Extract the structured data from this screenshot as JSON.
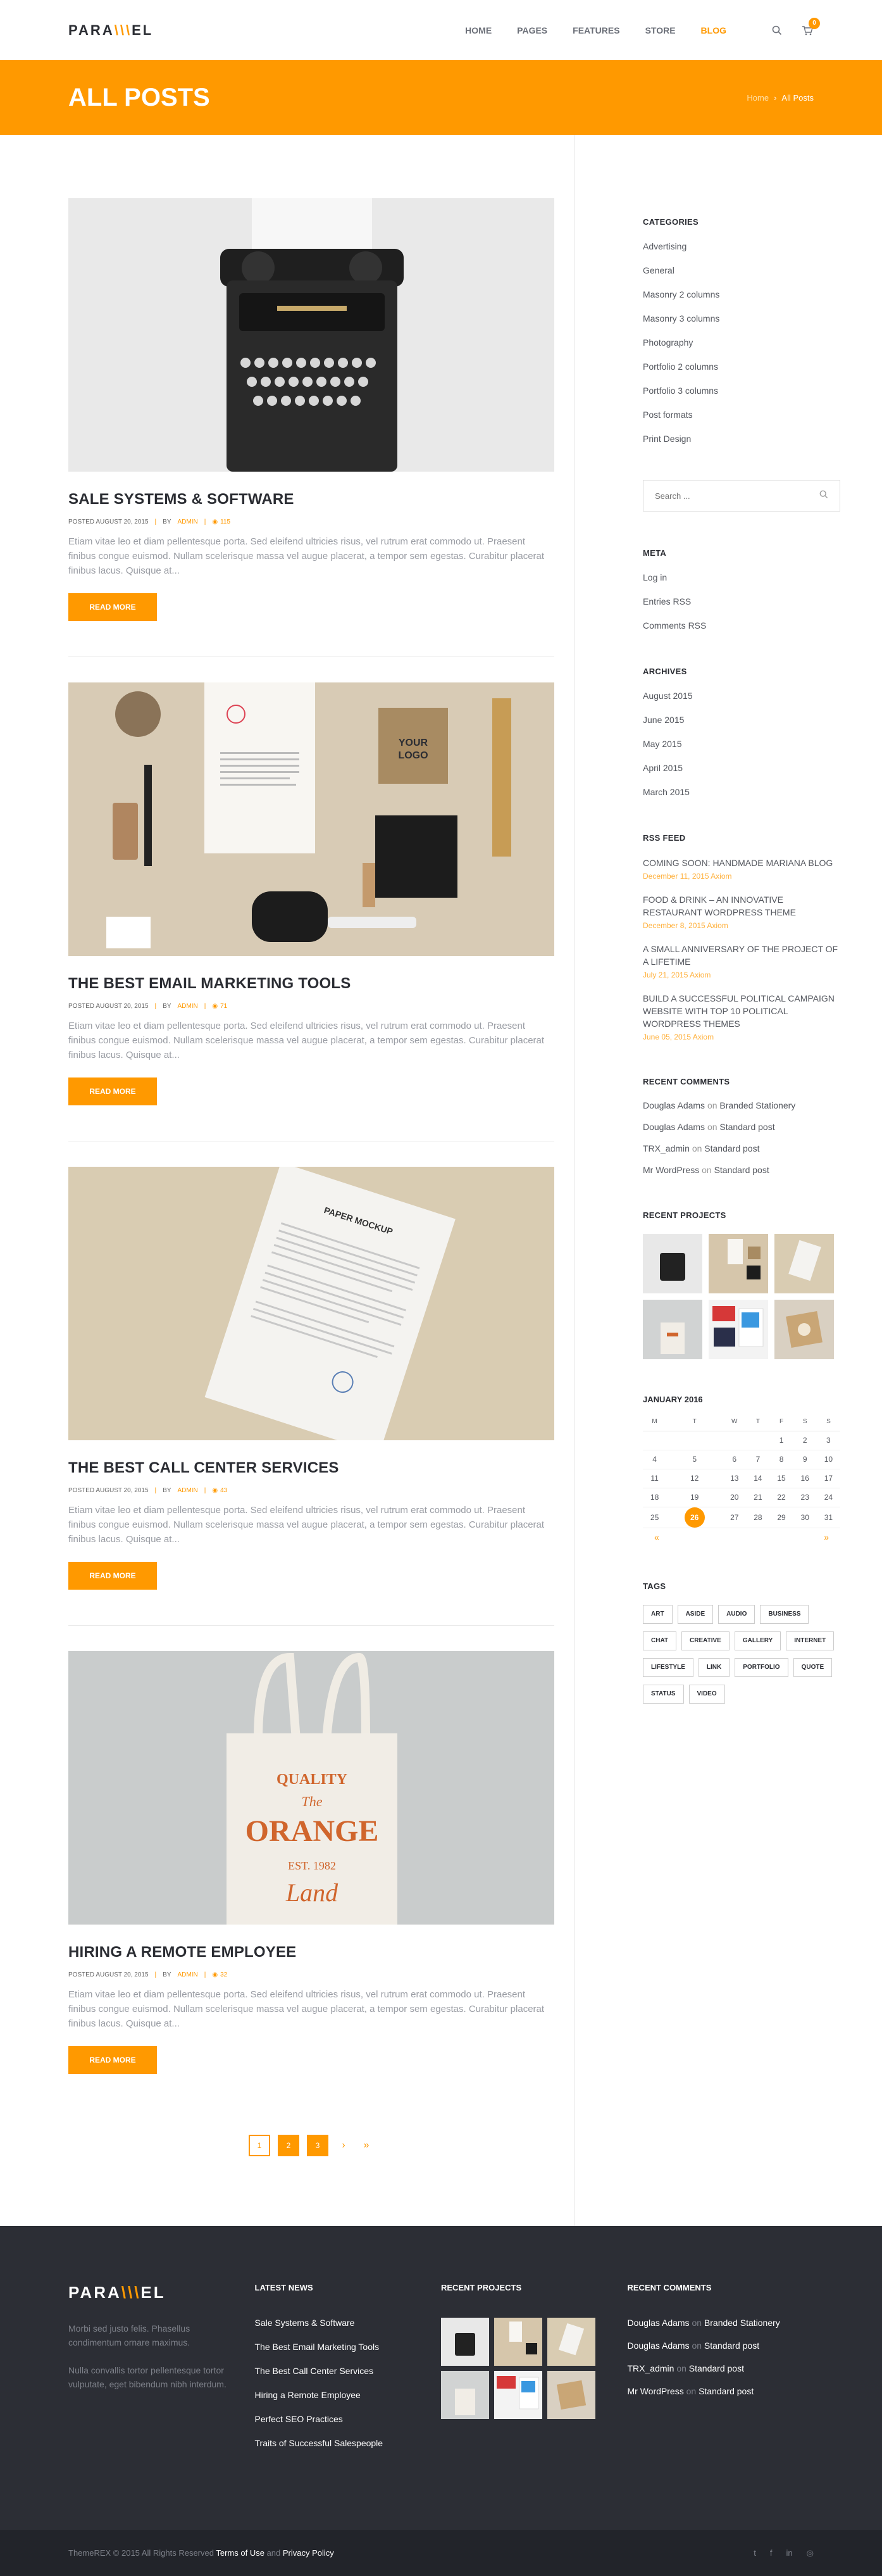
{
  "brand": {
    "logo_left": "PARA",
    "logo_slash": "\\\\\\",
    "logo_right": "EL"
  },
  "nav": {
    "items": [
      {
        "label": "HOME"
      },
      {
        "label": "PAGES"
      },
      {
        "label": "FEATURES"
      },
      {
        "label": "STORE"
      },
      {
        "label": "BLOG"
      }
    ],
    "cart_count": "0"
  },
  "titlebar": {
    "title": "ALL POSTS",
    "breadcrumb_home": "Home",
    "breadcrumb_sep": "›",
    "breadcrumb_current": "All Posts"
  },
  "posts": [
    {
      "title": "SALE SYSTEMS & SOFTWARE",
      "date": "POSTED AUGUST 20, 2015",
      "author_prefix": "BY",
      "author": "ADMIN",
      "views": "115",
      "excerpt": "Etiam vitae leo et diam pellentesque porta. Sed eleifend ultricies risus, vel rutrum erat commodo ut. Praesent finibus congue euismod. Nullam scelerisque massa vel augue placerat, a tempor sem egestas. Curabitur placerat finibus lacus. Quisque at...",
      "read_more": "READ MORE"
    },
    {
      "title": "THE BEST EMAIL MARKETING TOOLS",
      "date": "POSTED AUGUST 20, 2015",
      "author_prefix": "BY",
      "author": "ADMIN",
      "views": "71",
      "excerpt": "Etiam vitae leo et diam pellentesque porta. Sed eleifend ultricies risus, vel rutrum erat commodo ut. Praesent finibus congue euismod. Nullam scelerisque massa vel augue placerat, a tempor sem egestas. Curabitur placerat finibus lacus. Quisque at...",
      "read_more": "READ MORE"
    },
    {
      "title": "THE BEST CALL CENTER SERVICES",
      "date": "POSTED AUGUST 20, 2015",
      "author_prefix": "BY",
      "author": "ADMIN",
      "views": "43",
      "excerpt": "Etiam vitae leo et diam pellentesque porta. Sed eleifend ultricies risus, vel rutrum erat commodo ut. Praesent finibus congue euismod. Nullam scelerisque massa vel augue placerat, a tempor sem egestas. Curabitur placerat finibus lacus. Quisque at...",
      "read_more": "READ MORE"
    },
    {
      "title": "HIRING A REMOTE EMPLOYEE",
      "date": "POSTED AUGUST 20, 2015",
      "author_prefix": "BY",
      "author": "ADMIN",
      "views": "32",
      "excerpt": "Etiam vitae leo et diam pellentesque porta. Sed eleifend ultricies risus, vel rutrum erat commodo ut. Praesent finibus congue euismod. Nullam scelerisque massa vel augue placerat, a tempor sem egestas. Curabitur placerat finibus lacus. Quisque at...",
      "read_more": "READ MORE"
    }
  ],
  "pagination": {
    "pages": [
      "1",
      "2",
      "3"
    ],
    "next": "›",
    "last": "»"
  },
  "sidebar": {
    "categories_title": "CATEGORIES",
    "categories": [
      "Advertising",
      "General",
      "Masonry 2 columns",
      "Masonry 3 columns",
      "Photography",
      "Portfolio 2 columns",
      "Portfolio 3 columns",
      "Post formats",
      "Print Design"
    ],
    "search_placeholder": "Search ...",
    "meta_title": "META",
    "meta": [
      "Log in",
      "Entries RSS",
      "Comments RSS"
    ],
    "archives_title": "ARCHIVES",
    "archives": [
      "August 2015",
      "June 2015",
      "May 2015",
      "April 2015",
      "March 2015"
    ],
    "rss_title": "RSS FEED",
    "rss": [
      {
        "title": "COMING SOON: HANDMADE MARIANA BLOG",
        "date": "December 11, 2015 Axiom"
      },
      {
        "title": "FOOD & DRINK – AN INNOVATIVE RESTAURANT WORDPRESS THEME",
        "date": "December 8, 2015 Axiom"
      },
      {
        "title": "A SMALL ANNIVERSARY OF THE PROJECT OF A LIFETIME",
        "date": "July 21, 2015 Axiom"
      },
      {
        "title": "BUILD A SUCCESSFUL POLITICAL CAMPAIGN WEBSITE WITH TOP 10 POLITICAL WORDPRESS THEMES",
        "date": "June 05, 2015 Axiom"
      }
    ],
    "comments_title": "RECENT COMMENTS",
    "comments": [
      {
        "author": "Douglas Adams",
        "on": "on",
        "post": "Branded Stationery"
      },
      {
        "author": "Douglas Adams",
        "on": "on",
        "post": "Standard post"
      },
      {
        "author": "TRX_admin",
        "on": "on",
        "post": "Standard post"
      },
      {
        "author": "Mr WordPress",
        "on": "on",
        "post": "Standard post"
      }
    ],
    "projects_title": "RECENT PROJECTS",
    "calendar": {
      "title": "JANUARY 2016",
      "days": [
        "M",
        "T",
        "W",
        "T",
        "F",
        "S",
        "S"
      ],
      "weeks": [
        [
          "",
          "",
          "",
          "",
          "1",
          "2",
          "3"
        ],
        [
          "4",
          "5",
          "6",
          "7",
          "8",
          "9",
          "10"
        ],
        [
          "11",
          "12",
          "13",
          "14",
          "15",
          "16",
          "17"
        ],
        [
          "18",
          "19",
          "20",
          "21",
          "22",
          "23",
          "24"
        ],
        [
          "25",
          "26",
          "27",
          "28",
          "29",
          "30",
          "31"
        ]
      ],
      "today": "26",
      "prev": "«",
      "next": "»"
    },
    "tags_title": "TAGS",
    "tags": [
      "ART",
      "ASIDE",
      "AUDIO",
      "BUSINESS",
      "CHAT",
      "CREATIVE",
      "GALLERY",
      "INTERNET",
      "LIFESTYLE",
      "LINK",
      "PORTFOLIO",
      "QUOTE",
      "STATUS",
      "VIDEO"
    ]
  },
  "footer": {
    "text1": "Morbi sed justo felis. Phasellus condimentum ornare maximus.",
    "text2": "Nulla convallis tortor pellentesque tortor vulputate, eget bibendum nibh interdum.",
    "news_title": "LATEST NEWS",
    "news": [
      "Sale Systems & Software",
      "The Best Email Marketing Tools",
      "The Best Call Center Services",
      "Hiring a Remote Employee",
      "Perfect SEO Practices",
      "Traits of Successful Salespeople"
    ],
    "projects_title": "RECENT PROJECTS",
    "comments_title": "RECENT COMMENTS",
    "comments": [
      {
        "author": "Douglas Adams",
        "on": "on",
        "post": "Branded Stationery"
      },
      {
        "author": "Douglas Adams",
        "on": "on",
        "post": "Standard post"
      },
      {
        "author": "TRX_admin",
        "on": "on",
        "post": "Standard post"
      },
      {
        "author": "Mr WordPress",
        "on": "on",
        "post": "Standard post"
      }
    ],
    "copyright_prefix": "ThemeREX © 2015 All Rights Reserved",
    "terms": "Terms of Use",
    "and": "and",
    "privacy": "Privacy Policy",
    "socials": [
      "twitter-icon",
      "facebook-icon",
      "linkedin-icon",
      "instagram-icon"
    ],
    "social_glyphs": [
      "t",
      "f",
      "in",
      "◎"
    ]
  },
  "colors": {
    "accent": "#ff9900",
    "dark": "#2c2e35"
  }
}
